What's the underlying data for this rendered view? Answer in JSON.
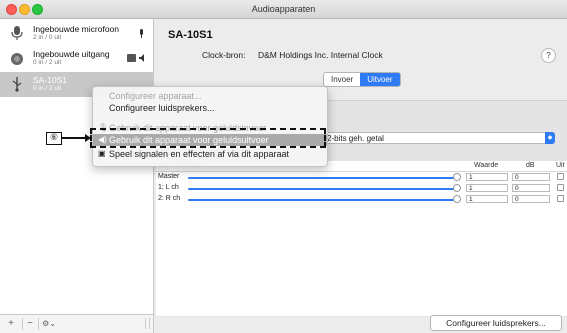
{
  "window": {
    "title": "Audioapparaten"
  },
  "sidebar": {
    "devices": [
      {
        "name": "Ingebouwde microfoon",
        "sub": "2 in / 0 uit",
        "icon": "microphone-icon"
      },
      {
        "name": "Ingebouwde uitgang",
        "sub": "0 in / 2 uit",
        "icon": "speaker-icon"
      },
      {
        "name": "SA-10S1",
        "sub": "0 in / 2 uit",
        "icon": "usb-icon"
      }
    ],
    "bottom": {
      "add": "+",
      "remove": "−",
      "gear": "⚙︎⌄"
    }
  },
  "main": {
    "device_title": "SA-10S1",
    "clock_label": "Clock-bron:",
    "clock_value": "D&M Holdings Inc. Internal Clock",
    "help": "?",
    "tabs": [
      {
        "label": "Invoer",
        "selected": false
      },
      {
        "label": "Uitvoer",
        "selected": true
      }
    ],
    "format_value": "2-bits geh. getal",
    "table": {
      "headers": [
        "Kan",
        "Volume",
        "Waarde",
        "dB",
        "Uit"
      ],
      "rows": [
        {
          "label": "Master",
          "waarde": "1",
          "db": "0"
        },
        {
          "label": "1: L ch",
          "waarde": "1",
          "db": "0"
        },
        {
          "label": "2: R ch",
          "waarde": "1",
          "db": "0"
        }
      ]
    },
    "configure_button": "Configureer luidsprekers..."
  },
  "context_menu": {
    "items": [
      {
        "label": "Configureer apparaat...",
        "disabled": true
      },
      {
        "label": "Configureer luidsprekers...",
        "disabled": false
      },
      {
        "label": "Gebruik dit apparaat voor geluidsinvoer",
        "disabled": true
      },
      {
        "label": "Gebruik dit apparaat voor geluidsuitvoer",
        "disabled": false,
        "highlighted": true
      },
      {
        "label": "Speel signalen en effecten af via dit apparaat",
        "disabled": false
      }
    ]
  },
  "annotation": {
    "label": "⑥"
  },
  "colors": {
    "accent": "#2f7bf5",
    "selection": "#c8c8c8"
  }
}
